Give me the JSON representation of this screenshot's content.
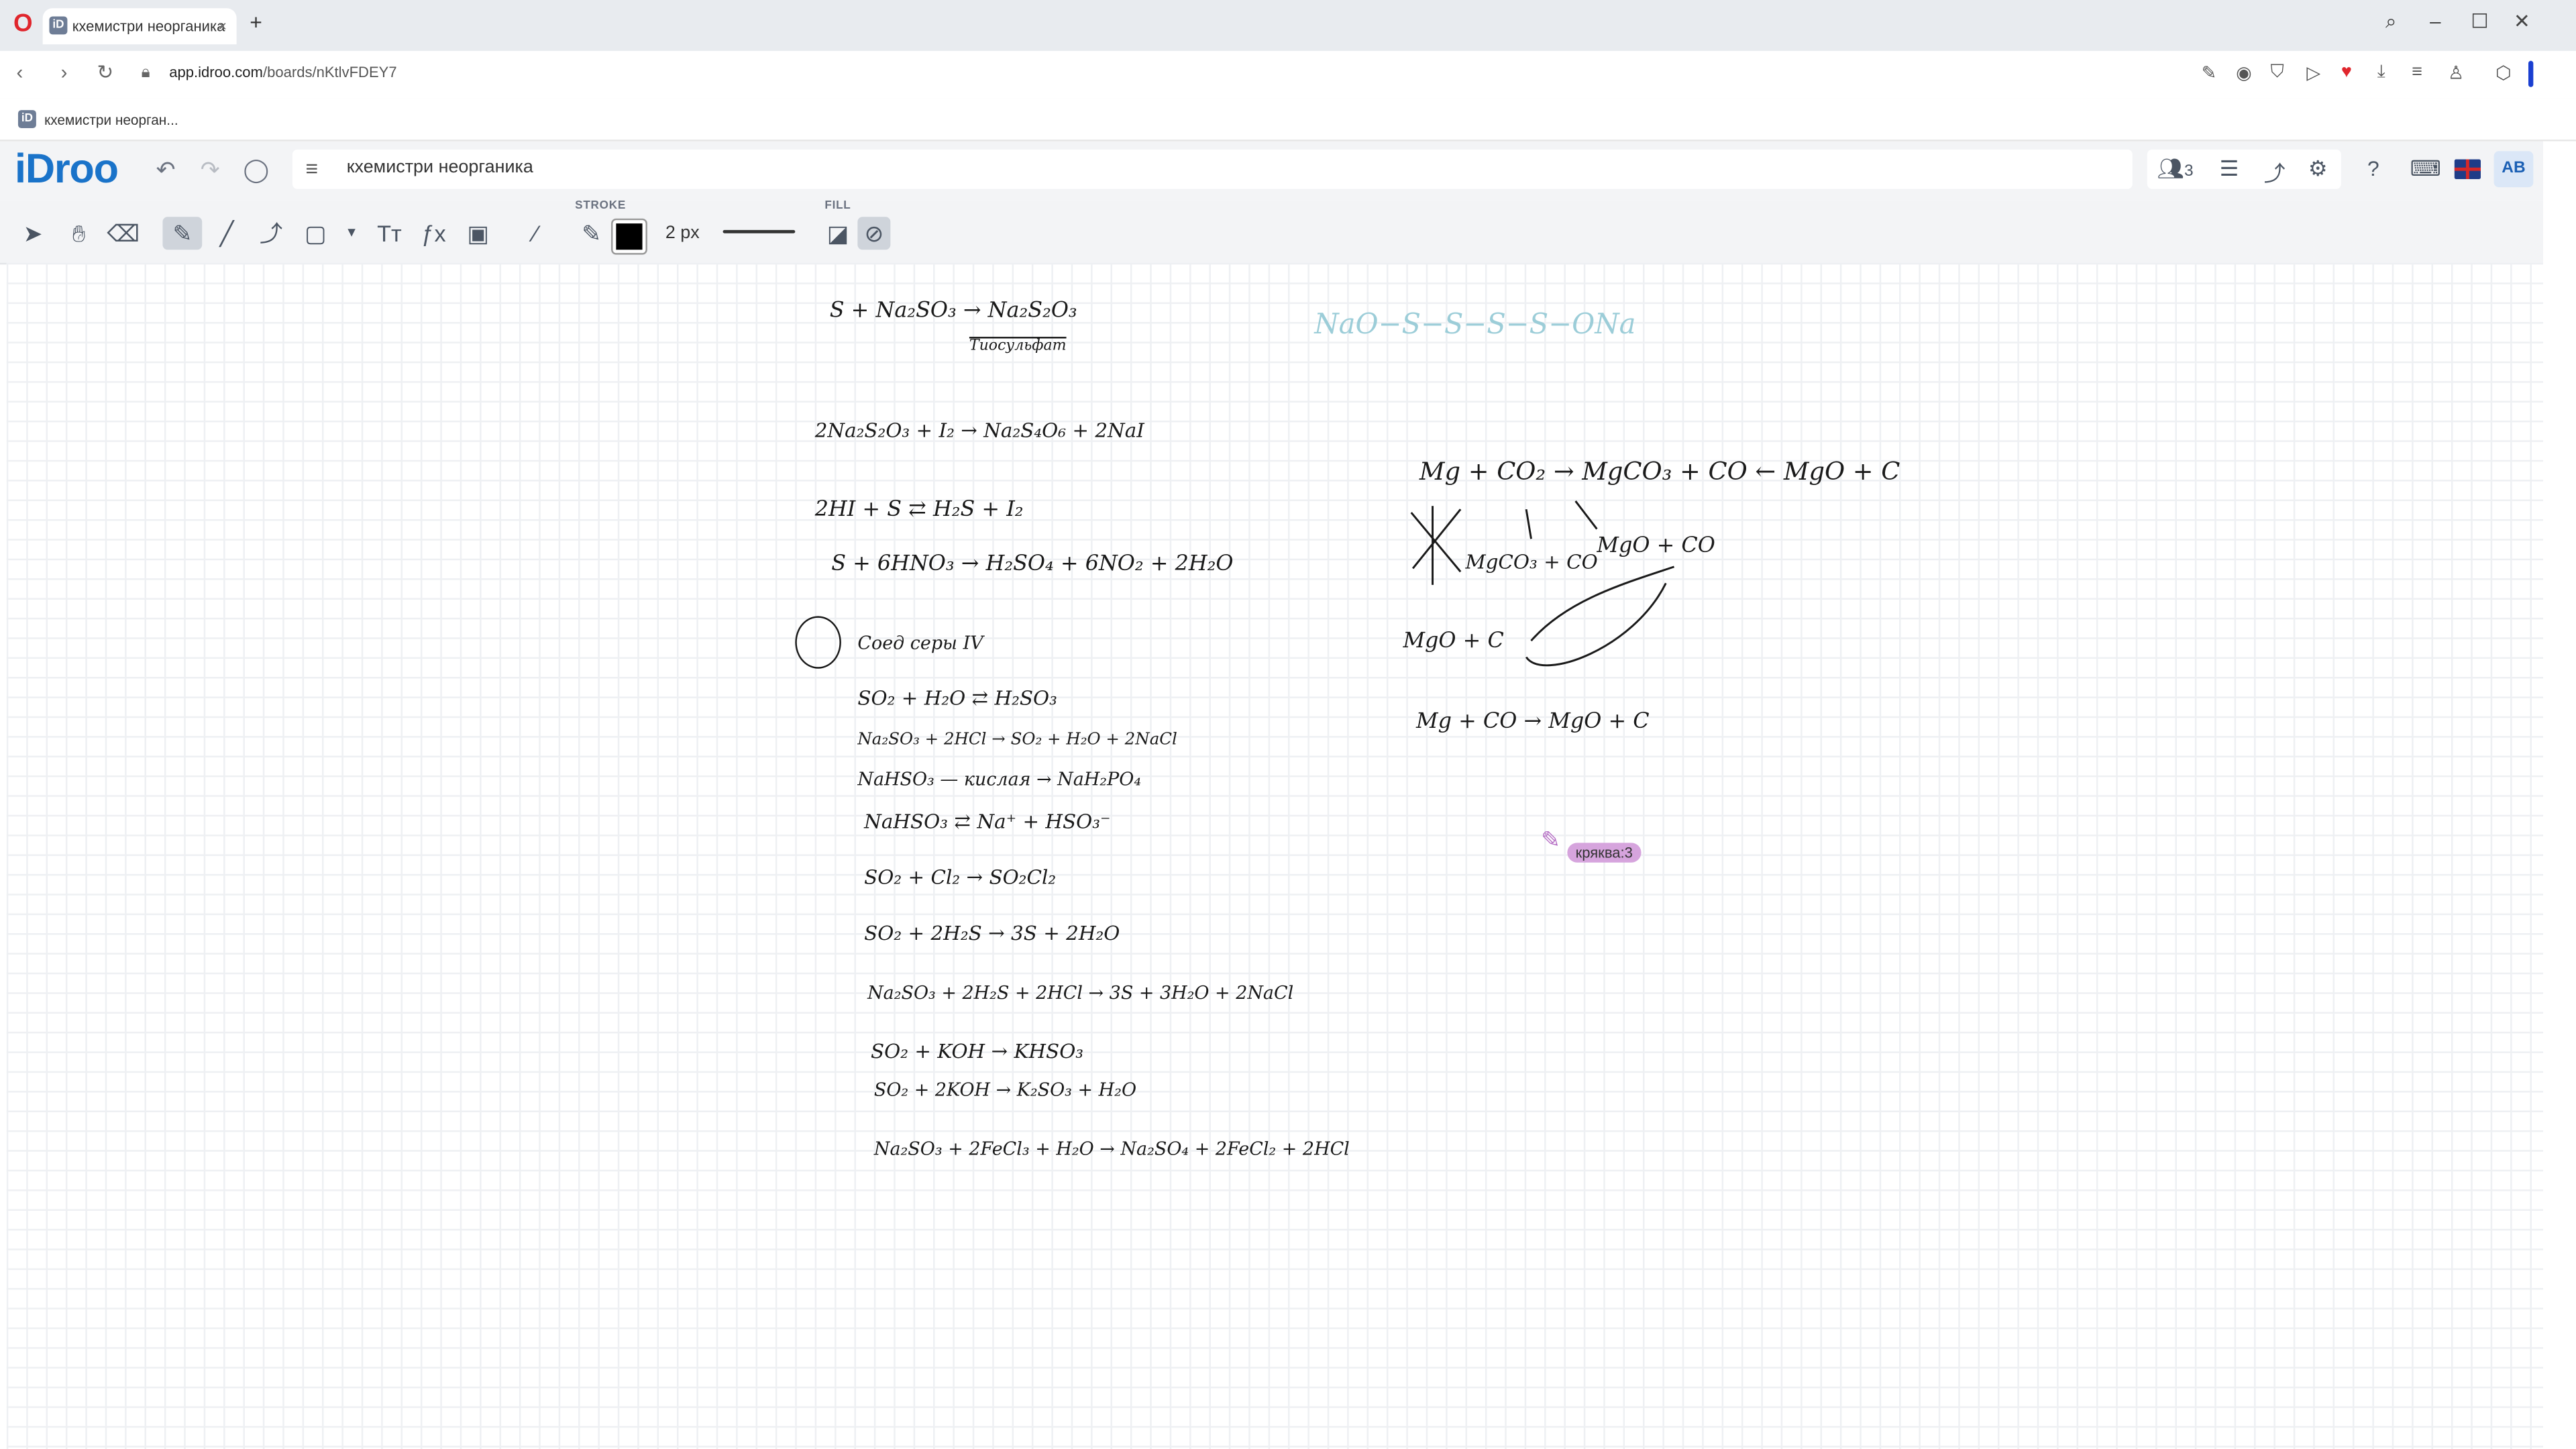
{
  "browser": {
    "tab_title": "кхемистри неорганика",
    "tab_favicon": "iD",
    "new_tab": "+",
    "url_domain": "app.idroo.com",
    "url_path": "/boards/nKtlvFDEY7",
    "bookmark_label": "кхемистри неорган..."
  },
  "app": {
    "logo": "iDroo",
    "board_title": "кхемистри неорганика",
    "users_count": "3",
    "avatar": "AB",
    "brand_color": "#1a73c9"
  },
  "toolbar": {
    "stroke_label": "STROKE",
    "fill_label": "FILL",
    "stroke_width": "2 px",
    "stroke_color": "#000000"
  },
  "canvas": {
    "lines_left": [
      "S + Na₂SO₃ → Na₂S₂O₃",
      "Тиосульфат",
      "2Na₂S₂O₃ + I₂ → Na₂S₄O₆ + 2NaI",
      "2HI + S ⇄ H₂S + I₂",
      "S + 6HNO₃ → H₂SO₄ + 6NO₂ + 2H₂O",
      "Соед серы IV",
      "SO₂ + H₂O ⇄ H₂SO₃",
      "Na₂SO₃ + 2HCl → SO₂ + H₂O + 2NaCl",
      "NaHSO₃ — кислая → NaH₂PO₄",
      "NaHSO₃ ⇄ Na⁺ + HSO₃⁻",
      "SO₂ + Cl₂ → SO₂Cl₂",
      "SO₂ + 2H₂S → 3S + 2H₂O",
      "Na₂SO₃ + 2H₂S + 2HCl → 3S + 3H₂O + 2NaCl",
      "SO₂ + KOH → KHSO₃",
      "SO₂ + 2KOH → K₂SO₃ + H₂O",
      "Na₂SO₃ + 2FeCl₃ + H₂O → Na₂SO₄ + 2FeCl₂ + 2HCl"
    ],
    "lines_right": [
      "Mg + CO₂ → MgCO₃ + CO ← MgO + C",
      "MgCO₃ + CO",
      "MgO + CO",
      "MgO + C",
      "Mg + CO → MgO + C"
    ],
    "struct_faint": "NaO−S−S−S−S−ONa",
    "cursor_tag": "кряква:3"
  }
}
